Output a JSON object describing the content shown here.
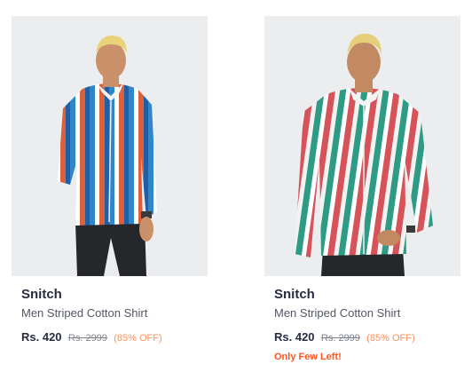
{
  "products": [
    {
      "brand": "Snitch",
      "name": "Men Striped Cotton Shirt",
      "price": "Rs. 420",
      "mrp": "Rs. 2999",
      "discount": "(85% OFF)",
      "urgency": "",
      "image_alt": "model wearing blue, white and orange striped shirt",
      "stripe_colors": [
        "#2f86c9",
        "#ffffff",
        "#d9623d",
        "#1e5fa8"
      ]
    },
    {
      "brand": "Snitch",
      "name": "Men Striped Cotton Shirt",
      "price": "Rs. 420",
      "mrp": "Rs. 2999",
      "discount": "(85% OFF)",
      "urgency": "Only Few Left!",
      "image_alt": "model wearing green, white and red striped shirt",
      "stripe_colors": [
        "#2e9b84",
        "#ffffff",
        "#d6535a",
        "#1f6e5e"
      ]
    }
  ],
  "colors": {
    "brand_text": "#282c3f",
    "discount": "#ff905a",
    "urgency": "#ff5722"
  }
}
